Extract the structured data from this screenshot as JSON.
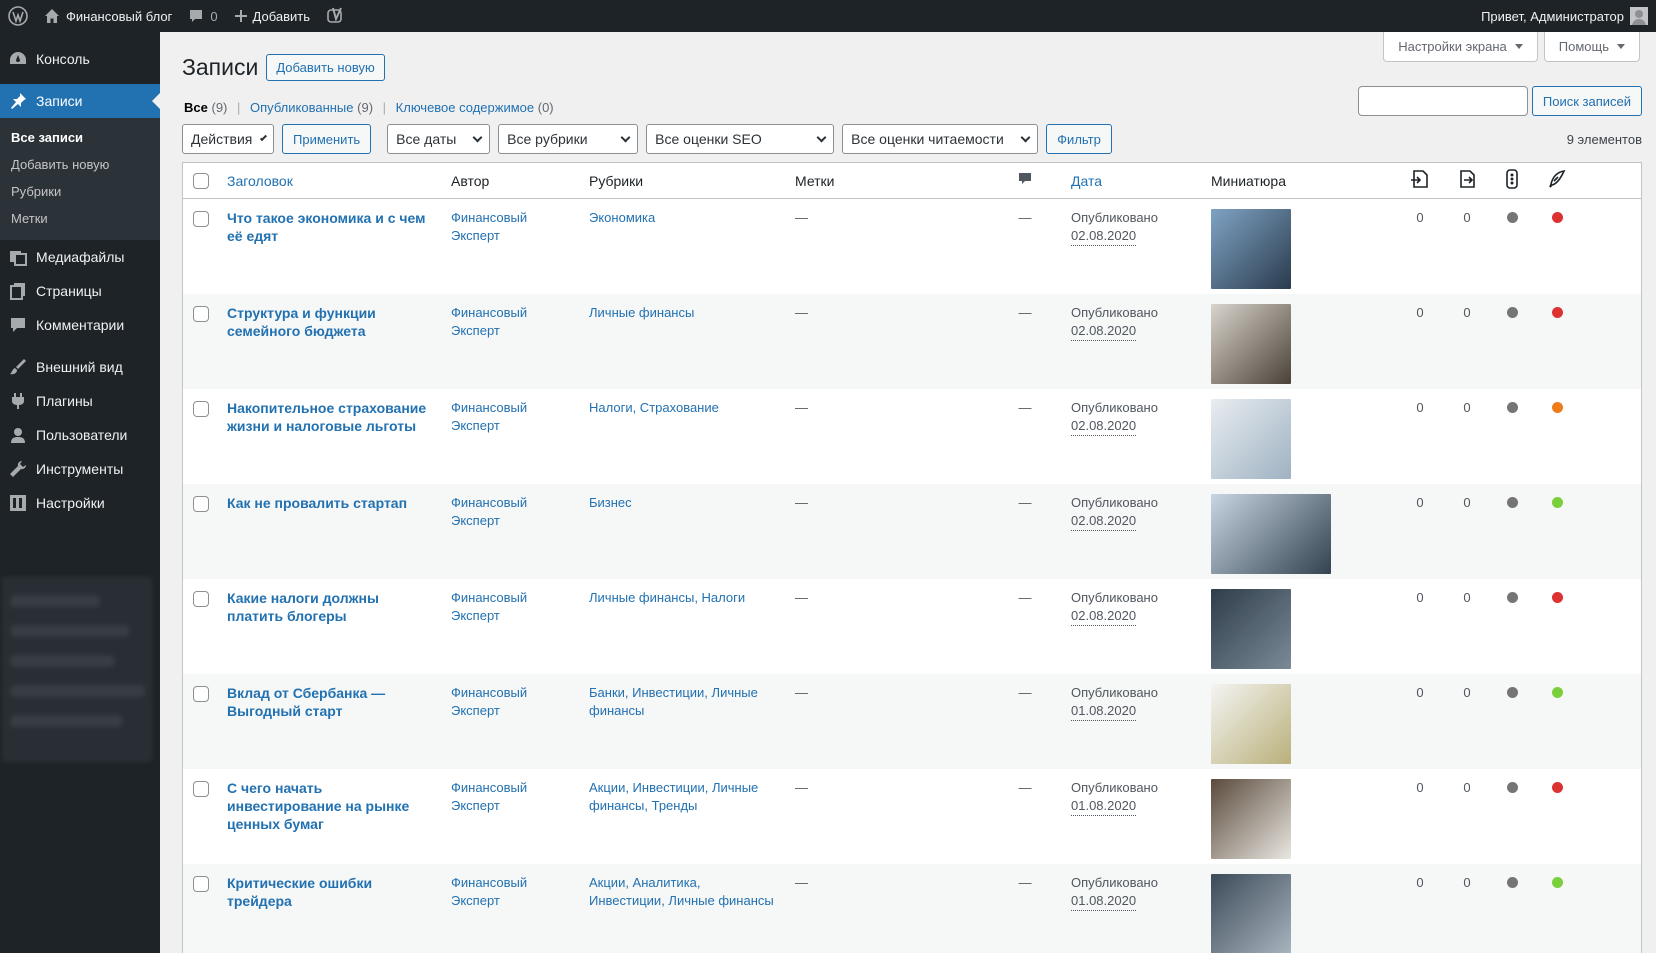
{
  "adminbar": {
    "site_name": "Финансовый блог",
    "comments_count": "0",
    "new_label": "Добавить",
    "greeting": "Привет, Администратор"
  },
  "sidebar": {
    "items": [
      {
        "label": "Консоль",
        "icon": "dashboard-icon"
      },
      {
        "label": "Записи",
        "icon": "pin-icon",
        "current": true
      },
      {
        "label": "Медиафайлы",
        "icon": "media-icon"
      },
      {
        "label": "Страницы",
        "icon": "pages-icon"
      },
      {
        "label": "Комментарии",
        "icon": "comments-icon"
      },
      {
        "label": "Внешний вид",
        "icon": "appearance-icon"
      },
      {
        "label": "Плагины",
        "icon": "plugins-icon"
      },
      {
        "label": "Пользователи",
        "icon": "users-icon"
      },
      {
        "label": "Инструменты",
        "icon": "tools-icon"
      },
      {
        "label": "Настройки",
        "icon": "settings-icon"
      }
    ],
    "submenu": [
      "Все записи",
      "Добавить новую",
      "Рубрики",
      "Метки"
    ]
  },
  "screen_meta": {
    "screen_options": "Настройки экрана",
    "help": "Помощь"
  },
  "page": {
    "title": "Записи",
    "add_new": "Добавить новую",
    "views": {
      "all": "Все",
      "all_count": "(9)",
      "published": "Опубликованные",
      "published_count": "(9)",
      "cornerstone": "Ключевое содержимое",
      "cornerstone_count": "(0)"
    },
    "search_button": "Поиск записей",
    "search_value": "",
    "bulk_actions": "Действия",
    "apply": "Применить",
    "dates": "Все даты",
    "categories": "Все рубрики",
    "seo": "Все оценки SEO",
    "readability": "Все оценки читаемости",
    "filter": "Фильтр",
    "items_count": "9 элементов"
  },
  "columns": {
    "title": "Заголовок",
    "author": "Автор",
    "categories": "Рубрики",
    "tags": "Метки",
    "date": "Дата",
    "thumbnail": "Миниатюра"
  },
  "status_colors": {
    "gray": "#757575",
    "red": "#dc3232",
    "orange": "#ee7c1b",
    "green": "#7ad03a"
  },
  "posts": [
    {
      "title": "Что такое экономика и с чем её едят",
      "author": "Финансовый Эксперт",
      "categories": "Экономика",
      "tags": "—",
      "comments": "—",
      "status": "Опубликовано",
      "date": "02.08.2020",
      "links_out": "0",
      "links_in": "0",
      "seo": "gray",
      "readability": "red",
      "thumb": [
        "#7fa3c4",
        "#2a3b4d"
      ],
      "wide": false
    },
    {
      "title": "Структура и функции семейного бюджета",
      "author": "Финансовый Эксперт",
      "categories": "Личные финансы",
      "tags": "—",
      "comments": "—",
      "status": "Опубликовано",
      "date": "02.08.2020",
      "links_out": "0",
      "links_in": "0",
      "seo": "gray",
      "readability": "red",
      "thumb": [
        "#d9d4cc",
        "#4a4238"
      ],
      "wide": false
    },
    {
      "title": "Накопительное страхование жизни и налоговые льготы",
      "author": "Финансовый Эксперт",
      "categories": "Налоги, Страхование",
      "tags": "—",
      "comments": "—",
      "status": "Опубликовано",
      "date": "02.08.2020",
      "links_out": "0",
      "links_in": "0",
      "seo": "gray",
      "readability": "orange",
      "thumb": [
        "#e8edf1",
        "#9fb2c2"
      ],
      "wide": false
    },
    {
      "title": "Как не провалить стартап",
      "author": "Финансовый Эксперт",
      "categories": "Бизнес",
      "tags": "—",
      "comments": "—",
      "status": "Опубликовано",
      "date": "02.08.2020",
      "links_out": "0",
      "links_in": "0",
      "seo": "gray",
      "readability": "green",
      "thumb": [
        "#c8d6e3",
        "#33424f"
      ],
      "wide": true
    },
    {
      "title": "Какие налоги должны платить блогеры",
      "author": "Финансовый Эксперт",
      "categories": "Личные финансы, Налоги",
      "tags": "—",
      "comments": "—",
      "status": "Опубликовано",
      "date": "02.08.2020",
      "links_out": "0",
      "links_in": "0",
      "seo": "gray",
      "readability": "red",
      "thumb": [
        "#2f3d4a",
        "#7a8a96"
      ],
      "wide": false
    },
    {
      "title": "Вклад от Сбербанка — Выгодный старт",
      "author": "Финансовый Эксперт",
      "categories": "Банки, Инвестиции, Личные финансы",
      "tags": "—",
      "comments": "—",
      "status": "Опубликовано",
      "date": "01.08.2020",
      "links_out": "0",
      "links_in": "0",
      "seo": "gray",
      "readability": "green",
      "thumb": [
        "#f4f4f2",
        "#b9b07a"
      ],
      "wide": false
    },
    {
      "title": "С чего начать инвестирование на рынке ценных бумаг",
      "author": "Финансовый Эксперт",
      "categories": "Акции, Инвестиции, Личные финансы, Тренды",
      "tags": "—",
      "comments": "—",
      "status": "Опубликовано",
      "date": "01.08.2020",
      "links_out": "0",
      "links_in": "0",
      "seo": "gray",
      "readability": "red",
      "thumb": [
        "#5a4a3c",
        "#e9e7e1"
      ],
      "wide": false
    },
    {
      "title": "Критические ошибки трейдера",
      "author": "Финансовый Эксперт",
      "categories": "Акции, Аналитика, Инвестиции, Личные финансы",
      "tags": "—",
      "comments": "—",
      "status": "Опубликовано",
      "date": "01.08.2020",
      "links_out": "0",
      "links_in": "0",
      "seo": "gray",
      "readability": "green",
      "thumb": [
        "#3c4a58",
        "#a8b4be"
      ],
      "wide": false
    }
  ]
}
